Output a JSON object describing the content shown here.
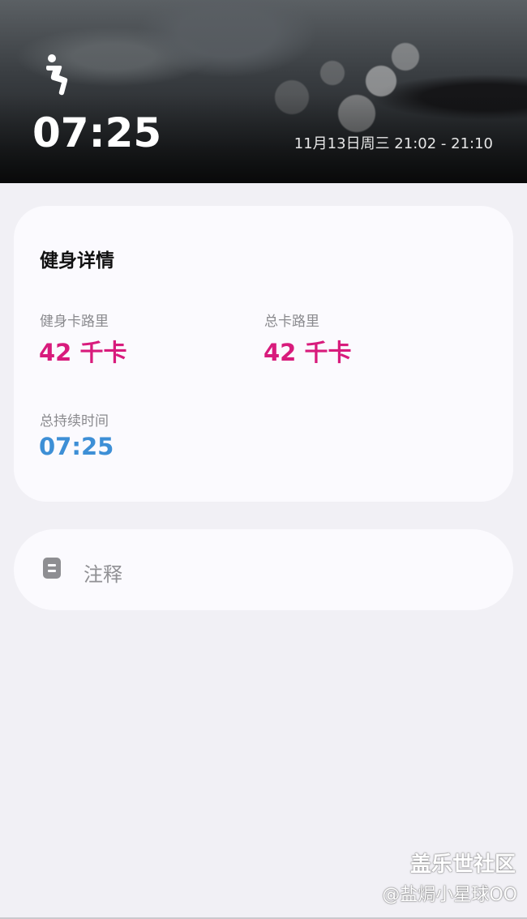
{
  "header": {
    "activity_icon": "squat-person-icon",
    "duration": "07:25",
    "date_range": "11月13日周三 21:02 - 21:10"
  },
  "details": {
    "title": "健身详情",
    "workout_calories": {
      "label": "健身卡路里",
      "value": "42 千卡"
    },
    "total_calories": {
      "label": "总卡路里",
      "value": "42 千卡"
    },
    "total_duration": {
      "label": "总持续时间",
      "value": "07:25"
    }
  },
  "notes": {
    "icon": "note-icon",
    "label": "注释"
  },
  "watermark": {
    "brand": "盖乐世社区",
    "user": "@盐焗小星球OO"
  },
  "colors": {
    "calorie_value": "#d81b7c",
    "duration_value": "#3d8fd6",
    "background": "#f1f0f5",
    "card": "#fbfafe"
  }
}
